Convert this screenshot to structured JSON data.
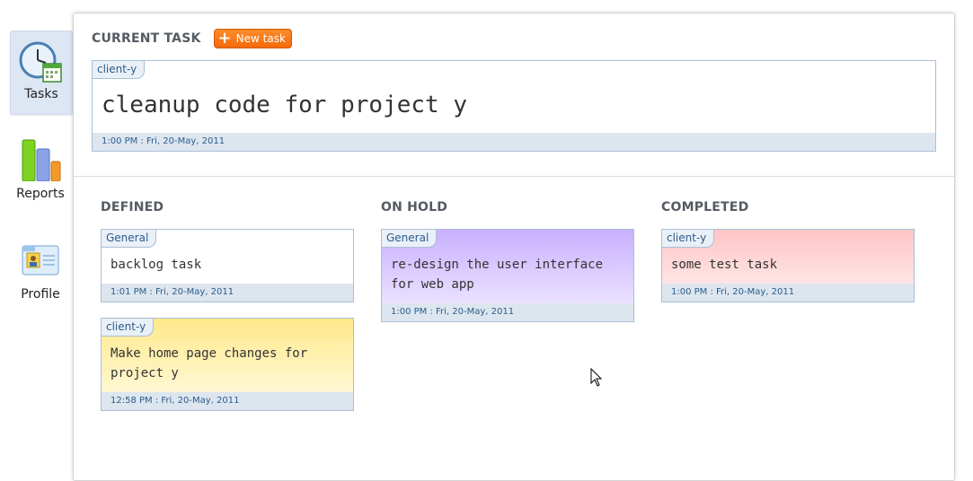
{
  "sidebar": {
    "items": [
      {
        "label": "Tasks",
        "icon": "clock-calendar-icon",
        "active": true
      },
      {
        "label": "Reports",
        "icon": "bar-chart-icon",
        "active": false
      },
      {
        "label": "Profile",
        "icon": "id-card-icon",
        "active": false
      }
    ]
  },
  "current": {
    "heading": "CURRENT TASK",
    "new_task_label": "New task",
    "tag": "client-y",
    "title": "cleanup code for project y",
    "timestamp": "1:00 PM : Fri, 20-May, 2011"
  },
  "columns": [
    {
      "title": "DEFINED",
      "tasks": [
        {
          "tag": "General",
          "text": "backlog task",
          "timestamp": "1:01 PM : Fri, 20-May, 2011",
          "color": "#ffffff"
        },
        {
          "tag": "client-y",
          "text": "Make home page changes for project y",
          "timestamp": "12:58 PM : Fri, 20-May, 2011",
          "color": "#ffe98a"
        }
      ]
    },
    {
      "title": "ON HOLD",
      "tasks": [
        {
          "tag": "General",
          "text": "re-design the user interface for web app",
          "timestamp": "1:00 PM : Fri, 20-May, 2011",
          "color": "#c9b0ff"
        }
      ]
    },
    {
      "title": "COMPLETED",
      "tasks": [
        {
          "tag": "client-y",
          "text": "some test task",
          "timestamp": "1:00 PM : Fri, 20-May, 2011",
          "color": "#ffc4c4"
        }
      ]
    }
  ]
}
